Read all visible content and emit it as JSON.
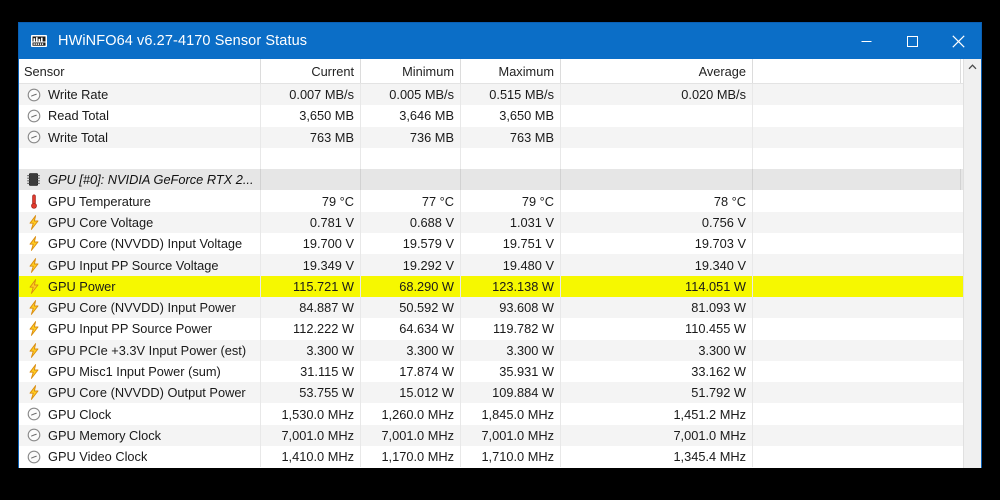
{
  "window": {
    "title": "HWiNFO64 v6.27-4170 Sensor Status",
    "app_icon": "hwinfo-icon",
    "controls": {
      "minimize": "—",
      "maximize": "□",
      "close": "✕"
    },
    "titlebar_color": "#0b6ec7",
    "highlight_color": "#f6f800"
  },
  "table": {
    "columns": [
      "Sensor",
      "Current",
      "Minimum",
      "Maximum",
      "Average"
    ],
    "rows": [
      {
        "type": "data",
        "icon": "gauge-icon",
        "sensor": "Write Rate",
        "current": "0.007 MB/s",
        "minimum": "0.005 MB/s",
        "maximum": "0.515 MB/s",
        "average": "0.020 MB/s"
      },
      {
        "type": "data",
        "icon": "gauge-icon",
        "sensor": "Read Total",
        "current": "3,650 MB",
        "minimum": "3,646 MB",
        "maximum": "3,650 MB",
        "average": ""
      },
      {
        "type": "data",
        "icon": "gauge-icon",
        "sensor": "Write Total",
        "current": "763 MB",
        "minimum": "736 MB",
        "maximum": "763 MB",
        "average": ""
      },
      {
        "type": "spacer",
        "icon": "",
        "sensor": "",
        "current": "",
        "minimum": "",
        "maximum": "",
        "average": ""
      },
      {
        "type": "group",
        "icon": "chip-icon",
        "sensor": "GPU [#0]: NVIDIA GeForce RTX 2...",
        "current": "",
        "minimum": "",
        "maximum": "",
        "average": ""
      },
      {
        "type": "data",
        "icon": "thermometer-icon",
        "sensor": "GPU Temperature",
        "current": "79 °C",
        "minimum": "77 °C",
        "maximum": "79 °C",
        "average": "78 °C"
      },
      {
        "type": "data",
        "icon": "bolt-icon",
        "sensor": "GPU Core Voltage",
        "current": "0.781 V",
        "minimum": "0.688 V",
        "maximum": "1.031 V",
        "average": "0.756 V"
      },
      {
        "type": "data",
        "icon": "bolt-icon",
        "sensor": "GPU Core (NVVDD) Input Voltage",
        "current": "19.700 V",
        "minimum": "19.579 V",
        "maximum": "19.751 V",
        "average": "19.703 V"
      },
      {
        "type": "data",
        "icon": "bolt-icon",
        "sensor": "GPU Input PP Source Voltage",
        "current": "19.349 V",
        "minimum": "19.292 V",
        "maximum": "19.480 V",
        "average": "19.340 V"
      },
      {
        "type": "highlight",
        "icon": "bolt-icon",
        "sensor": "GPU Power",
        "current": "115.721 W",
        "minimum": "68.290 W",
        "maximum": "123.138 W",
        "average": "114.051 W"
      },
      {
        "type": "data",
        "icon": "bolt-icon",
        "sensor": "GPU Core (NVVDD) Input Power",
        "current": "84.887 W",
        "minimum": "50.592 W",
        "maximum": "93.608 W",
        "average": "81.093 W"
      },
      {
        "type": "data",
        "icon": "bolt-icon",
        "sensor": "GPU Input PP Source Power",
        "current": "112.222 W",
        "minimum": "64.634 W",
        "maximum": "119.782 W",
        "average": "110.455 W"
      },
      {
        "type": "data",
        "icon": "bolt-icon",
        "sensor": "GPU PCIe +3.3V Input Power (est)",
        "current": "3.300 W",
        "minimum": "3.300 W",
        "maximum": "3.300 W",
        "average": "3.300 W"
      },
      {
        "type": "data",
        "icon": "bolt-icon",
        "sensor": "GPU Misc1 Input Power (sum)",
        "current": "31.115 W",
        "minimum": "17.874 W",
        "maximum": "35.931 W",
        "average": "33.162 W"
      },
      {
        "type": "data",
        "icon": "bolt-icon",
        "sensor": "GPU Core (NVVDD) Output Power",
        "current": "53.755 W",
        "minimum": "15.012 W",
        "maximum": "109.884 W",
        "average": "51.792 W"
      },
      {
        "type": "data",
        "icon": "gauge-icon",
        "sensor": "GPU Clock",
        "current": "1,530.0 MHz",
        "minimum": "1,260.0 MHz",
        "maximum": "1,845.0 MHz",
        "average": "1,451.2 MHz"
      },
      {
        "type": "data",
        "icon": "gauge-icon",
        "sensor": "GPU Memory Clock",
        "current": "7,001.0 MHz",
        "minimum": "7,001.0 MHz",
        "maximum": "7,001.0 MHz",
        "average": "7,001.0 MHz"
      },
      {
        "type": "data",
        "icon": "gauge-icon",
        "sensor": "GPU Video Clock",
        "current": "1,410.0 MHz",
        "minimum": "1,170.0 MHz",
        "maximum": "1,710.0 MHz",
        "average": "1,345.4 MHz"
      }
    ]
  },
  "scrollbar": {
    "up_arrow": "⌃",
    "name": "vertical-scrollbar"
  }
}
